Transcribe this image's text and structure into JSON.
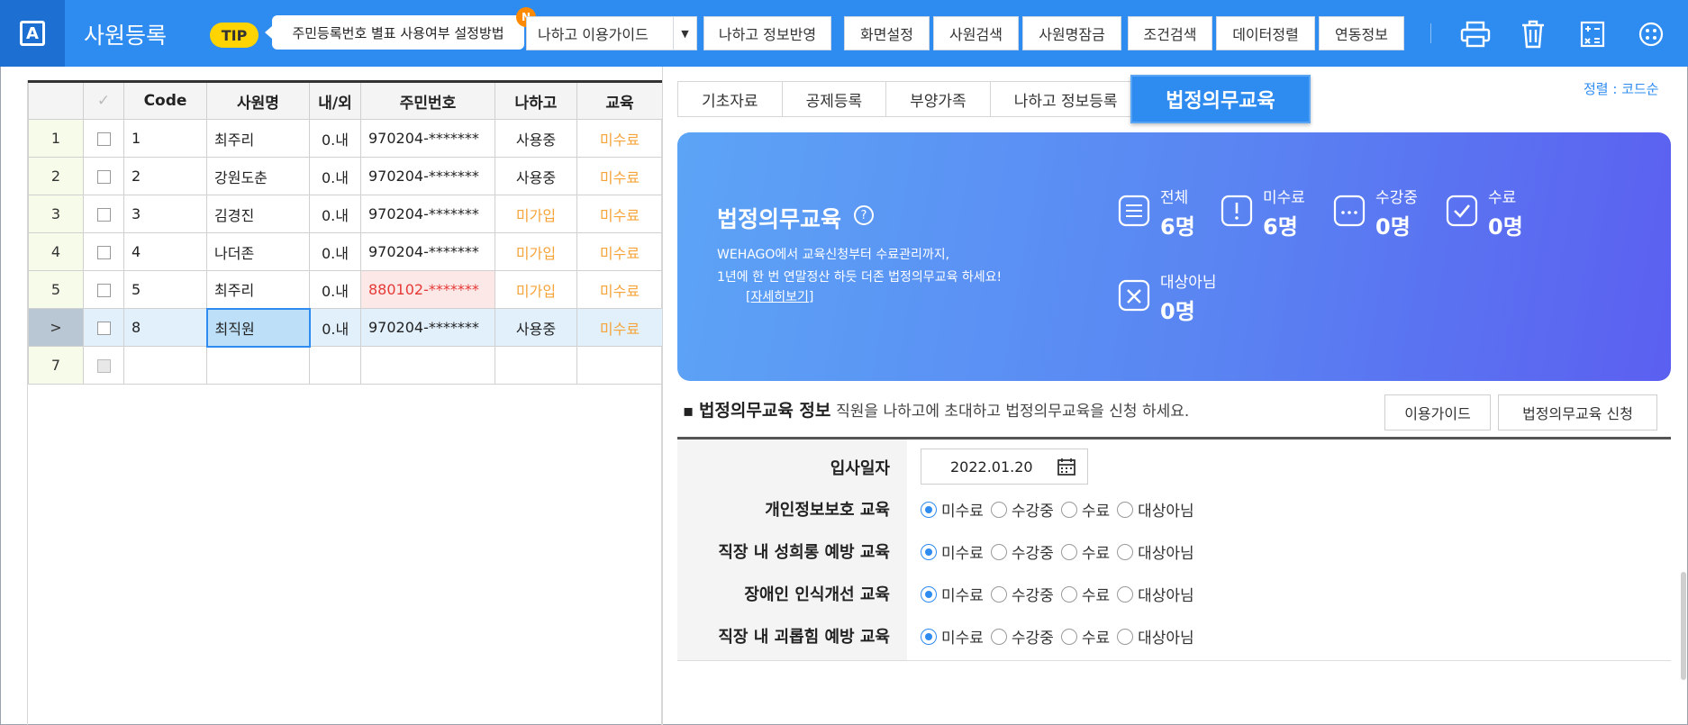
{
  "app": {
    "logo_letter": "A",
    "title": "사원등록"
  },
  "toolbar": {
    "tip_label": "TIP",
    "tip_text": "주민등록번호 별표 사용여부 설정방법",
    "new_badge": "N",
    "guide_dropdown": "나하고 이용가이드",
    "buttons": [
      "나하고 정보반영",
      "화면설정",
      "사원검색",
      "사원명잠금",
      "조건검색",
      "데이터정렬",
      "연동정보"
    ],
    "icons": [
      "print-icon",
      "trash-icon",
      "calculator-icon",
      "more-icon"
    ]
  },
  "grid": {
    "headers": [
      "",
      "✓",
      "Code",
      "사원명",
      "내/외",
      "주민번호",
      "나하고",
      "교육"
    ],
    "rows": [
      {
        "no": "1",
        "code": "1",
        "name": "최주리",
        "type": "0.내",
        "rrn": "970204-*******",
        "nahago": "사용중",
        "edu": "미수료",
        "nahago_status": "active",
        "rrn_error": false,
        "selected": false
      },
      {
        "no": "2",
        "code": "2",
        "name": "강원도춘",
        "type": "0.내",
        "rrn": "970204-*******",
        "nahago": "사용중",
        "edu": "미수료",
        "nahago_status": "active",
        "rrn_error": false,
        "selected": false
      },
      {
        "no": "3",
        "code": "3",
        "name": "김경진",
        "type": "0.내",
        "rrn": "970204-*******",
        "nahago": "미가입",
        "edu": "미수료",
        "nahago_status": "inactive",
        "rrn_error": false,
        "selected": false
      },
      {
        "no": "4",
        "code": "4",
        "name": "나더존",
        "type": "0.내",
        "rrn": "970204-*******",
        "nahago": "미가입",
        "edu": "미수료",
        "nahago_status": "inactive",
        "rrn_error": false,
        "selected": false
      },
      {
        "no": "5",
        "code": "5",
        "name": "최주리",
        "type": "0.내",
        "rrn": "880102-*******",
        "nahago": "미가입",
        "edu": "미수료",
        "nahago_status": "inactive",
        "rrn_error": true,
        "selected": false
      },
      {
        "no": ">",
        "code": "8",
        "name": "최직원",
        "type": "0.내",
        "rrn": "970204-*******",
        "nahago": "사용중",
        "edu": "미수료",
        "nahago_status": "active",
        "rrn_error": false,
        "selected": true
      },
      {
        "no": "7",
        "code": "",
        "name": "",
        "type": "",
        "rrn": "",
        "nahago": "",
        "edu": "",
        "nahago_status": "",
        "rrn_error": false,
        "selected": false,
        "empty": true
      }
    ]
  },
  "tabs": [
    "기초자료",
    "공제등록",
    "부양가족",
    "나하고 정보등록"
  ],
  "active_tab": "법정의무교육",
  "sort_label": "정렬 : 코드순",
  "banner": {
    "title": "법정의무교육",
    "help": "?",
    "desc_line1": "WEHAGO에서 교육신청부터 수료관리까지,",
    "desc_line2": "1년에 한 번 연말정산 하듯 더존 법정의무교육 하세요!",
    "more_link": "[자세히보기]",
    "stats": [
      {
        "label": "전체",
        "value": "6명",
        "icon": "list-icon"
      },
      {
        "label": "미수료",
        "value": "6명",
        "icon": "alert-icon"
      },
      {
        "label": "수강중",
        "value": "0명",
        "icon": "progress-icon"
      },
      {
        "label": "수료",
        "value": "0명",
        "icon": "check-icon"
      },
      {
        "label": "대상아님",
        "value": "0명",
        "icon": "x-icon"
      }
    ]
  },
  "edu_section": {
    "bullet": "▪",
    "title": "법정의무교육 정보",
    "subtitle": "직원을 나하고에 초대하고 법정의무교육을 신청 하세요.",
    "guide_button": "이용가이드",
    "apply_button": "법정의무교육 신청",
    "hire_date_label": "입사일자",
    "hire_date": "2022.01.20",
    "radio_options": [
      "미수료",
      "수강중",
      "수료",
      "대상아님"
    ],
    "courses": [
      {
        "label": "개인정보보호 교육",
        "selected": "미수료"
      },
      {
        "label": "직장 내 성희롱 예방 교육",
        "selected": "미수료"
      },
      {
        "label": "장애인 인식개선 교육",
        "selected": "미수료"
      },
      {
        "label": "직장 내 괴롭힘 예방 교육",
        "selected": "미수료"
      }
    ]
  },
  "colors": {
    "primary": "#2e8bf0",
    "orange": "#f6a43a",
    "red": "#e53935",
    "banner_start": "#5ca4f6",
    "banner_end": "#5b5ff0"
  }
}
